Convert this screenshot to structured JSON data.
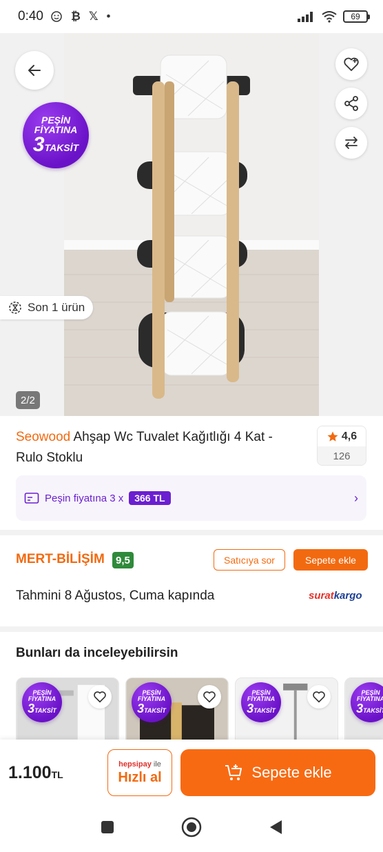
{
  "status_bar": {
    "time": "0:40",
    "battery": "69",
    "left_icons": [
      "emoji-status-icon",
      "bitcoin-icon",
      "x-icon",
      "dot-icon"
    ],
    "right_icons": [
      "signal-icon",
      "wifi-icon",
      "battery-icon"
    ]
  },
  "hero": {
    "promo_badge": {
      "line1": "PEŞİN",
      "line2": "FİYATINA",
      "big": "3",
      "small": "TAKSİT"
    },
    "stock_label": "Son 1 ürün",
    "page_indicator": "2/2",
    "buttons": [
      "back-arrow-icon",
      "heart-plus-icon",
      "share-icon",
      "compare-icon"
    ]
  },
  "product": {
    "brand": "Seowood",
    "title": " Ahşap Wc Tuvalet Kağıtlığı 4 Kat - Rulo Stoklu",
    "rating": "4,6",
    "review_count": "126",
    "installment_label": "Peşin fiyatına 3 x",
    "installment_amount": "366 TL"
  },
  "seller": {
    "name": "MERT-BİLİŞİM",
    "score": "9,5",
    "ask_label": "Satıcıya sor",
    "add_label": "Sepete ekle",
    "delivery": "Tahmini 8 Ağustos, Cuma kapında",
    "cargo_brand_a": "surat",
    "cargo_brand_b": "kargo"
  },
  "recommendations": {
    "title": "Bunları da inceleyebilirsin",
    "badge": {
      "line1": "PEŞİN",
      "line2": "FİYATINA",
      "big": "3",
      "small": "TAKSİT"
    }
  },
  "bottom_bar": {
    "price": "1.100",
    "currency": "TL",
    "quick_pay_brand": "hepsipay",
    "quick_pay_suffix": " ile",
    "quick_pay_label": "Hızlı al",
    "add_to_cart": "Sepete ekle"
  },
  "colors": {
    "accent_orange": "#f26a10",
    "promo_purple": "#6b1fd1",
    "score_green": "#2f8a3b"
  }
}
